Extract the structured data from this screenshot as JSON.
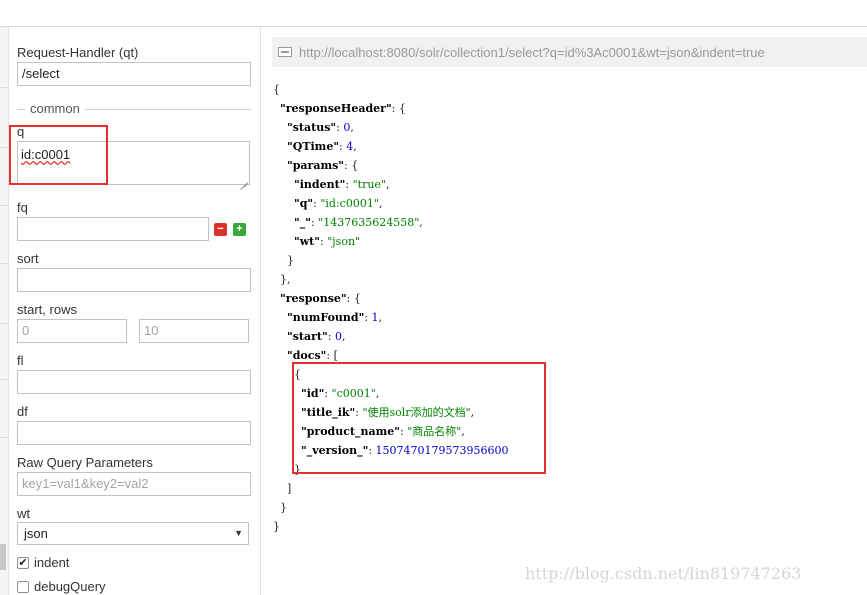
{
  "request_handler": {
    "label": "Request-Handler (qt)",
    "value": "/select"
  },
  "common_section": "common",
  "q": {
    "label": "q",
    "value": "id:c0001"
  },
  "fq": {
    "label": "fq",
    "value": ""
  },
  "sort": {
    "label": "sort",
    "value": ""
  },
  "start_rows": {
    "label": "start, rows",
    "start_placeholder": "0",
    "rows_placeholder": "10"
  },
  "fl": {
    "label": "fl",
    "value": ""
  },
  "df": {
    "label": "df",
    "value": ""
  },
  "raw_query": {
    "label": "Raw Query Parameters",
    "placeholder": "key1=val1&key2=val2"
  },
  "wt": {
    "label": "wt",
    "selected": "json"
  },
  "indent": {
    "label": "indent",
    "checked": true
  },
  "debug_query": {
    "label": "debugQuery",
    "checked": false
  },
  "url": "http://localhost:8080/solr/collection1/select?q=id%3Ac0001&wt=json&indent=true",
  "json_lines": [
    [
      [
        "p",
        "{"
      ]
    ],
    [
      [
        "p",
        "  "
      ],
      [
        "k",
        "\"responseHeader\""
      ],
      [
        "p",
        ": {"
      ]
    ],
    [
      [
        "p",
        "    "
      ],
      [
        "k",
        "\"status\""
      ],
      [
        "p",
        ": "
      ],
      [
        "n",
        "0"
      ],
      [
        "p",
        ","
      ]
    ],
    [
      [
        "p",
        "    "
      ],
      [
        "k",
        "\"QTime\""
      ],
      [
        "p",
        ": "
      ],
      [
        "n",
        "4"
      ],
      [
        "p",
        ","
      ]
    ],
    [
      [
        "p",
        "    "
      ],
      [
        "k",
        "\"params\""
      ],
      [
        "p",
        ": {"
      ]
    ],
    [
      [
        "p",
        "      "
      ],
      [
        "k",
        "\"indent\""
      ],
      [
        "p",
        ": "
      ],
      [
        "s",
        "\"true\""
      ],
      [
        "p",
        ","
      ]
    ],
    [
      [
        "p",
        "      "
      ],
      [
        "k",
        "\"q\""
      ],
      [
        "p",
        ": "
      ],
      [
        "s",
        "\"id:c0001\""
      ],
      [
        "p",
        ","
      ]
    ],
    [
      [
        "p",
        "      "
      ],
      [
        "k",
        "\"_\""
      ],
      [
        "p",
        ": "
      ],
      [
        "s",
        "\"1437635624558\""
      ],
      [
        "p",
        ","
      ]
    ],
    [
      [
        "p",
        "      "
      ],
      [
        "k",
        "\"wt\""
      ],
      [
        "p",
        ": "
      ],
      [
        "s",
        "\"json\""
      ]
    ],
    [
      [
        "p",
        "    }"
      ]
    ],
    [
      [
        "p",
        "  },"
      ]
    ],
    [
      [
        "p",
        "  "
      ],
      [
        "k",
        "\"response\""
      ],
      [
        "p",
        ": {"
      ]
    ],
    [
      [
        "p",
        "    "
      ],
      [
        "k",
        "\"numFound\""
      ],
      [
        "p",
        ": "
      ],
      [
        "n",
        "1"
      ],
      [
        "p",
        ","
      ]
    ],
    [
      [
        "p",
        "    "
      ],
      [
        "k",
        "\"start\""
      ],
      [
        "p",
        ": "
      ],
      [
        "n",
        "0"
      ],
      [
        "p",
        ","
      ]
    ],
    [
      [
        "p",
        "    "
      ],
      [
        "k",
        "\"docs\""
      ],
      [
        "p",
        ": ["
      ]
    ],
    [
      [
        "p",
        "      {"
      ]
    ],
    [
      [
        "p",
        "        "
      ],
      [
        "k",
        "\"id\""
      ],
      [
        "p",
        ": "
      ],
      [
        "s",
        "\"c0001\""
      ],
      [
        "p",
        ","
      ]
    ],
    [
      [
        "p",
        "        "
      ],
      [
        "k",
        "\"title_ik\""
      ],
      [
        "p",
        ": "
      ],
      [
        "s",
        "\"使用solr添加的文档\""
      ],
      [
        "p",
        ","
      ]
    ],
    [
      [
        "p",
        "        "
      ],
      [
        "k",
        "\"product_name\""
      ],
      [
        "p",
        ": "
      ],
      [
        "s",
        "\"商品名称\""
      ],
      [
        "p",
        ","
      ]
    ],
    [
      [
        "p",
        "        "
      ],
      [
        "k",
        "\"_version_\""
      ],
      [
        "p",
        ": "
      ],
      [
        "n",
        "1507470179573956600"
      ]
    ],
    [
      [
        "p",
        "      }"
      ]
    ],
    [
      [
        "p",
        "    ]"
      ]
    ],
    [
      [
        "p",
        "  }"
      ]
    ],
    [
      [
        "p",
        "}"
      ]
    ]
  ],
  "watermark": "http://blog.csdn.net/lin819747263",
  "colors": {
    "highlight": "#e53030",
    "number": "#0000cc",
    "string": "#008000",
    "minus_button": "#d9342b",
    "plus_button": "#3aa63a"
  }
}
